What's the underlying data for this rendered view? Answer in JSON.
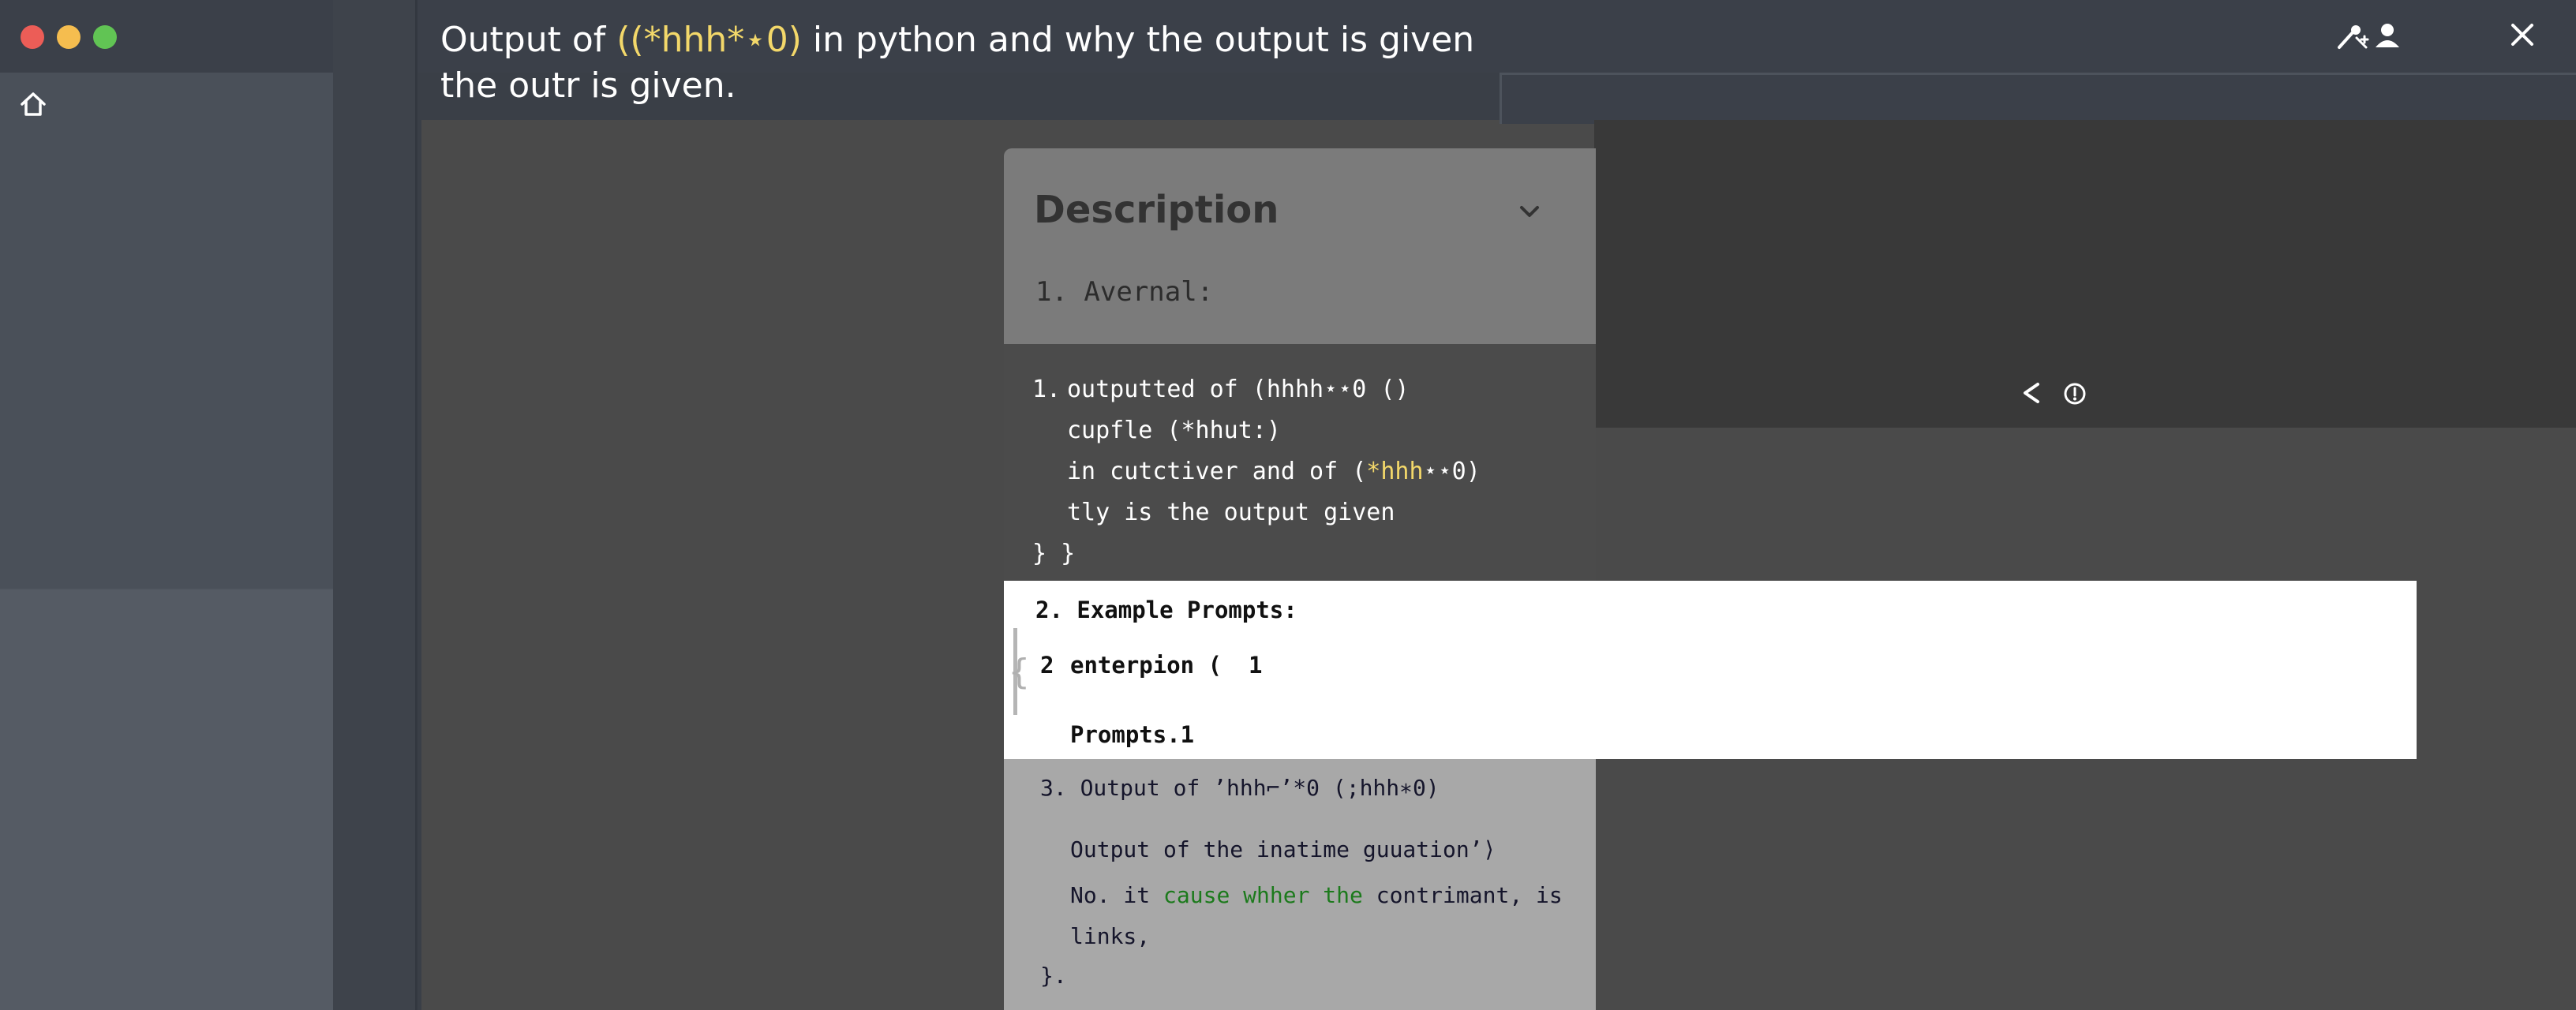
{
  "window": {
    "colors": {
      "close": "#ec5d57",
      "minimize": "#f5bd4f",
      "zoom": "#61c454"
    }
  },
  "header": {
    "title_prefix": "Output of ",
    "title_code": "((*hhh*⋆0)",
    "title_suffix": " in python and why the output is given",
    "title_line2": "the outr is given."
  },
  "icons": {
    "home": "home-icon",
    "share": "share-icon",
    "info": "info-icon",
    "user": "user-icon",
    "collapse": "user-collapse-icon",
    "close": "close-icon"
  },
  "description": {
    "heading": "Description",
    "section1_label": "1. Avernal:",
    "code_block": {
      "number": "1.",
      "line1": "outputted of (hhhh⋆⋆0 ()",
      "line2": "cupfle (*hhut:)",
      "line3_prefix": "in cutctiver and of (",
      "line3_highlight": "*hhh",
      "line3_suffix": "⋆⋆0)",
      "line4": "tly is the output given",
      "line5": "} }"
    },
    "section2": {
      "label": "2. Example Prompts:",
      "row_number": "2",
      "row_text": "enterpion (",
      "row_value": "1",
      "prompts": "Prompts.1"
    },
    "section3": {
      "label": "3. Output of ’hhh⌐’*0 (;hhh∗0)",
      "line1": "Output of the inatime guuation’⟩",
      "line2_prefix": "No. it ",
      "line2_green": "cause whher the",
      "line2_suffix": " contrimant, is",
      "line3": "links,",
      "line4": "}."
    }
  }
}
